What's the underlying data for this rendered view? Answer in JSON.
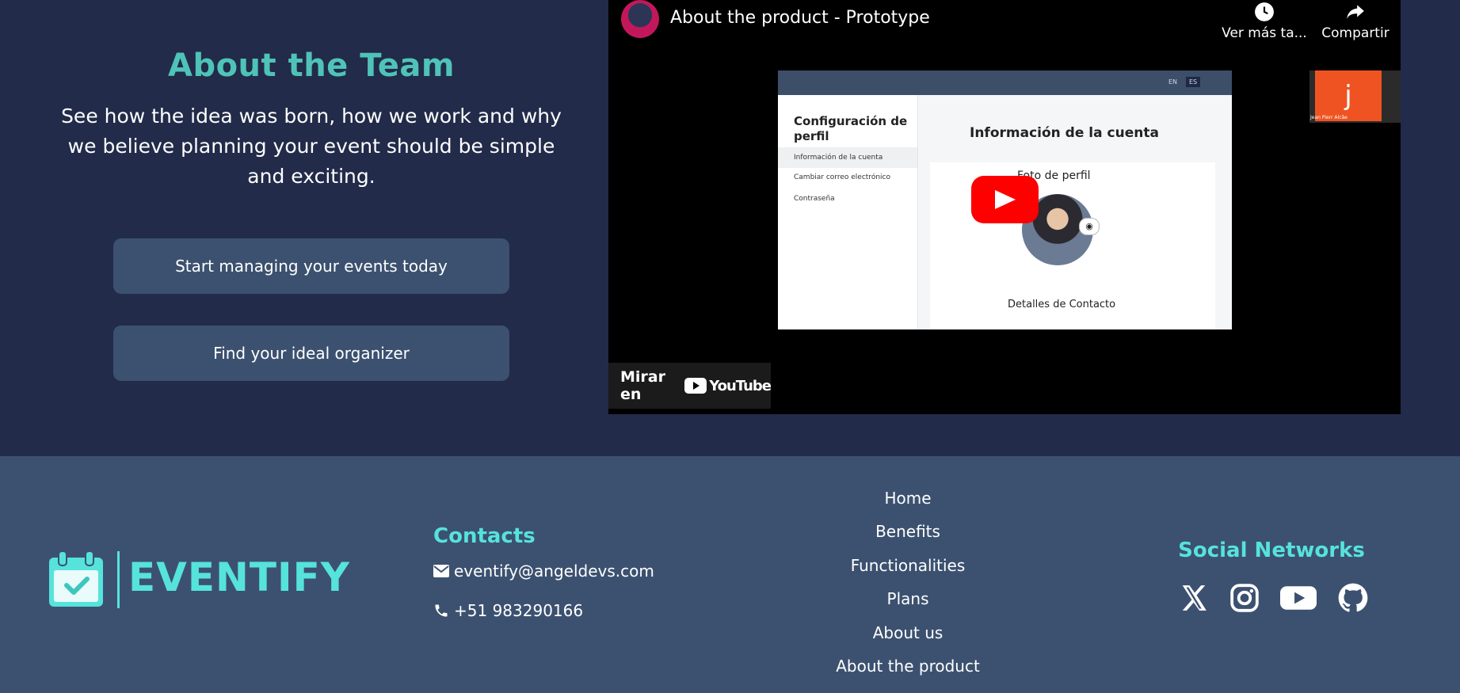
{
  "about": {
    "title": "About the Team",
    "description": "See how the idea was born, how we work and why we believe planning your event should be simple and exciting.",
    "cta_primary": "Start managing your events today",
    "cta_secondary": "Find your ideal organizer"
  },
  "video": {
    "title": "About the product - Prototype",
    "watch_later_label": "Ver más ta...",
    "share_label": "Compartir",
    "watch_on_label": "Mirar en",
    "youtube_wordmark": "YouTube",
    "screen": {
      "lang_en": "EN",
      "lang_es": "ES",
      "sidebar_title": "Configuración de perfil",
      "sidebar_items": [
        "Información de la cuenta",
        "Cambiar correo electrónico",
        "Contraseña"
      ],
      "heading": "Información de la cuenta",
      "photo_label": "Foto de perfil",
      "contact_label": "Detalles de Contacto"
    },
    "pip": {
      "initial": "j",
      "name": "Jean Pierr Alcâe"
    }
  },
  "footer": {
    "logo_text": "EVENTIFY",
    "contacts_title": "Contacts",
    "email": "eventify@angeldevs.com",
    "phone": "+51 983290166",
    "nav": [
      "Home",
      "Benefits",
      "Functionalities",
      "Plans",
      "About us",
      "About the product"
    ],
    "social_title": "Social Networks",
    "social_icons": [
      "x-icon",
      "instagram-icon",
      "youtube-icon",
      "github-icon"
    ]
  },
  "colors": {
    "page_bg": "#222b49",
    "footer_bg": "#3c5170",
    "accent_teal": "#56e3dc",
    "title_teal": "#4fc3b8",
    "button_bg": "#3c5170",
    "youtube_red": "#ff0000"
  }
}
